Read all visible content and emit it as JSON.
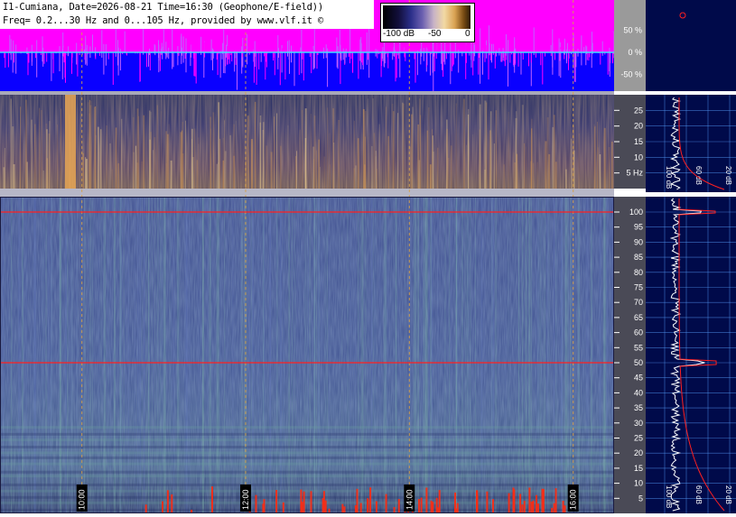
{
  "header": {
    "line1": "I1-Cumiana, Date=2026-08-21 Time=16:30 (Geophone/E-field))",
    "line2": "Freq= 0.2...30 Hz and 0...105 Hz, provided by www.vlf.it ©"
  },
  "colorbar": {
    "labels": [
      "-100 dB",
      "-50",
      "0"
    ],
    "unit": "dB"
  },
  "colors": {
    "background_panel": "#000a4a",
    "amplitude_fill": "#0a00ff",
    "amplitude_band": "#ff00ff",
    "spectral_line": "#ff2020",
    "grid": "#5aa0ff",
    "time_marker": "#d4a04a"
  },
  "chart_data": [
    {
      "type": "area",
      "name": "amplitude-strip",
      "yaxis": {
        "ticks": [
          "50 %",
          "0 %",
          "-50 %"
        ],
        "range": [
          -100,
          100
        ],
        "unit": "%"
      },
      "x": {
        "ticks": [
          "10:00",
          "12:00",
          "14:00",
          "16:00"
        ]
      }
    },
    {
      "type": "heatmap",
      "name": "low-frequency-spectrogram",
      "yaxis": {
        "ticks": [
          "5 Hz",
          "10",
          "15",
          "20",
          "25"
        ],
        "range": [
          0,
          30
        ],
        "unit": "Hz"
      },
      "x": {
        "ticks": [
          "10:00",
          "12:00",
          "14:00",
          "16:00"
        ]
      },
      "side_spectrum": {
        "xaxis_ticks": [
          "100 dB",
          "60 dB",
          "20 dB"
        ]
      }
    },
    {
      "type": "heatmap",
      "name": "wide-frequency-spectrogram",
      "yaxis": {
        "ticks": [
          "5",
          "10",
          "15",
          "20",
          "25",
          "30",
          "35",
          "40",
          "45",
          "50",
          "55",
          "60",
          "65",
          "70",
          "75",
          "80",
          "85",
          "90",
          "95",
          "100"
        ],
        "range": [
          0,
          105
        ],
        "unit": "Hz"
      },
      "x": {
        "ticks": [
          "10:00",
          "12:00",
          "14:00",
          "16:00"
        ],
        "range": [
          "09:00",
          "16:30"
        ]
      },
      "spectral_lines_hz": [
        50,
        100
      ],
      "side_spectrum": {
        "xaxis_ticks": [
          "100 dB",
          "60 dB",
          "20 dB"
        ]
      }
    }
  ]
}
